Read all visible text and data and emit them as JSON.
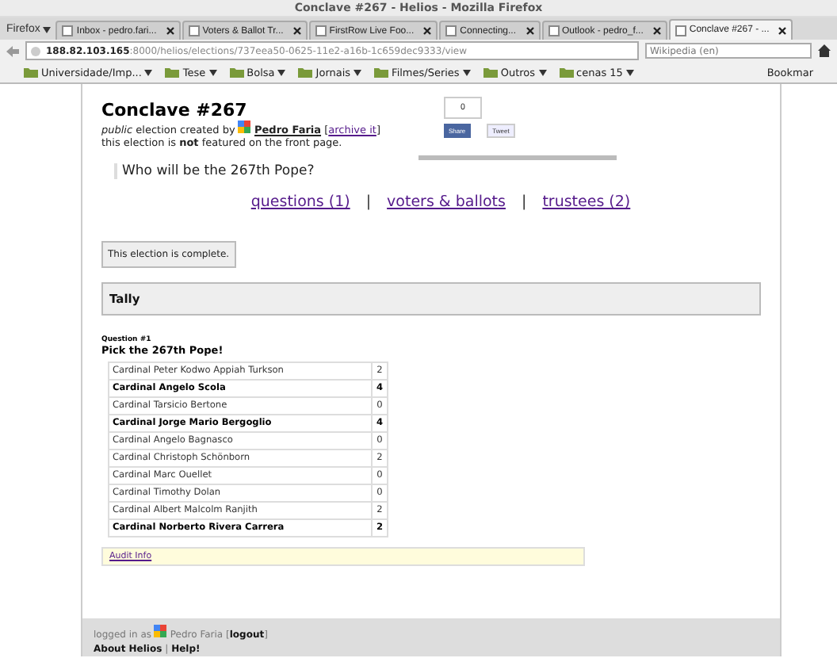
{
  "window": {
    "title": "Conclave #267 - Helios - Mozilla Firefox"
  },
  "browser": {
    "menu_label": "Firefox",
    "tabs": [
      {
        "label": "Inbox - pedro.fari...",
        "selected": false
      },
      {
        "label": "Voters & Ballot Tr...",
        "selected": false
      },
      {
        "label": "FirstRow Live Foo...",
        "selected": false
      },
      {
        "label": "Connecting...",
        "selected": false
      },
      {
        "label": "Outlook - pedro_f...",
        "selected": false
      },
      {
        "label": "Conclave #267 - ...",
        "selected": true
      }
    ],
    "url_host": "188.82.103.165",
    "url_rest": ":8000/helios/elections/737eea50-0625-11e2-a16b-1c659dec9333/view",
    "search": {
      "placeholder": "Wikipedia (en)"
    },
    "bookmarks": [
      "Universidade/Imp...",
      "Tese",
      "Bolsa",
      "Jornais",
      "Filmes/Series",
      "Outros",
      "cenas 15"
    ],
    "bookmarks_menu": "Bookmar"
  },
  "election": {
    "title": "Conclave #267",
    "visibility": "public",
    "created_by": "election created by",
    "admin": "Pedro Faria",
    "archive_link": "archive it",
    "featured_note": "this election is **not** featured on the front page.",
    "share": {
      "count": "0",
      "share_label": "Share",
      "tweet_label": "Tweet"
    },
    "description": "Who will be the 267th Pope?",
    "nav_links": [
      "questions (1)",
      "voters & ballots",
      "trustees (2)"
    ],
    "nav_separator": "|",
    "bracket_open": "[",
    "bracket_close": "]",
    "status": "This election is complete."
  },
  "tally": {
    "heading": "Tally",
    "question_label": "Question #1",
    "question": "Pick the 267th Pope!",
    "rows": [
      {
        "name": "Cardinal Peter Kodwo Appiah Turkson",
        "votes": "2",
        "bold": false
      },
      {
        "name": "Cardinal Angelo Scola",
        "votes": "4",
        "bold": true
      },
      {
        "name": "Cardinal Tarsicio Bertone",
        "votes": "0",
        "bold": false
      },
      {
        "name": "Cardinal Jorge Mario Bergoglio",
        "votes": "4",
        "bold": true
      },
      {
        "name": "Cardinal Angelo Bagnasco",
        "votes": "0",
        "bold": false
      },
      {
        "name": "Cardinal Christoph Schönborn",
        "votes": "2",
        "bold": false
      },
      {
        "name": "Cardinal Marc Ouellet",
        "votes": "0",
        "bold": false
      },
      {
        "name": "Cardinal Timothy Dolan",
        "votes": "0",
        "bold": false
      },
      {
        "name": "Cardinal Albert Malcolm Ranjith",
        "votes": "2",
        "bold": false
      },
      {
        "name": "Cardinal Norberto Rivera Carrera",
        "votes": "2",
        "bold": true
      }
    ]
  },
  "audit_link": "Audit Info",
  "footer": {
    "logged_in_as": "logged in as",
    "user": "Pedro Faria",
    "logout": "logout",
    "bracket_open": "[",
    "bracket_close": "]",
    "separator": "|",
    "about": "About Helios",
    "help": "Help!"
  }
}
